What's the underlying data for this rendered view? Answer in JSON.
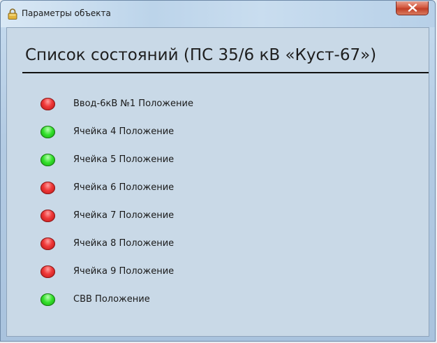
{
  "window": {
    "title": "Параметры объекта",
    "close_symbol": "✕"
  },
  "main": {
    "heading": "Список состояний (ПС 35/6 кВ «Куст-67»)",
    "states": [
      {
        "label": "Ввод-6кВ №1 Положение",
        "status": "red"
      },
      {
        "label": "Ячейка 4 Положение",
        "status": "green"
      },
      {
        "label": "Ячейка 5 Положение",
        "status": "green"
      },
      {
        "label": "Ячейка 6 Положение",
        "status": "red"
      },
      {
        "label": "Ячейка 7 Положение",
        "status": "red"
      },
      {
        "label": "Ячейка 8 Положение",
        "status": "red"
      },
      {
        "label": "Ячейка 9 Положение",
        "status": "red"
      },
      {
        "label": "СВВ Положение",
        "status": "green"
      }
    ]
  },
  "colors": {
    "status_red": "#e83232",
    "status_green": "#2fdc28"
  },
  "icons": {
    "app": "lock-icon",
    "close": "close-icon"
  }
}
